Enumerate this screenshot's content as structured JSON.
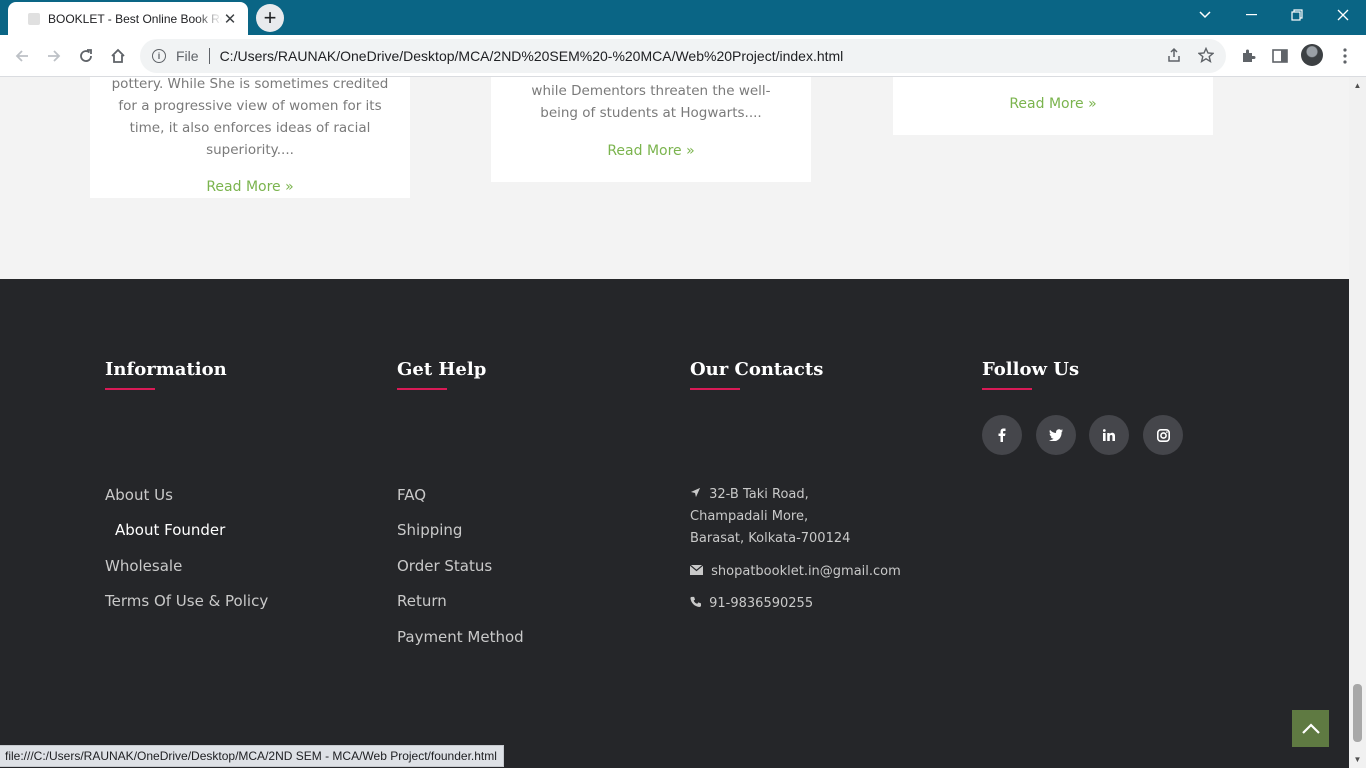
{
  "browser": {
    "tab_title": "BOOKLET - Best Online Book Reader",
    "new_tab_symbol": "+",
    "file_label": "File",
    "url": "C:/Users/RAUNAK/OneDrive/Desktop/MCA/2ND%20SEM%20-%20MCA/Web%20Project/index.html",
    "status_url": "file:///C:/Users/RAUNAK/OneDrive/Desktop/MCA/2ND SEM - MCA/Web Project/founder.html"
  },
  "cards": [
    {
      "excerpt": "pottery. While She is sometimes credited for a progressive view of women for its time, it also enforces ideas of racial superiority....",
      "read_more": "Read More »"
    },
    {
      "excerpt": "while Dementors threaten the well-being of students at Hogwarts....",
      "read_more": "Read More »"
    },
    {
      "excerpt": "",
      "read_more": "Read More »"
    }
  ],
  "footer": {
    "information": {
      "title": "Information",
      "links": [
        "About Us",
        "About Founder",
        "Wholesale",
        "Terms Of Use & Policy"
      ]
    },
    "get_help": {
      "title": "Get Help",
      "links": [
        "FAQ",
        "Shipping",
        "Order Status",
        "Return",
        "Payment Method"
      ]
    },
    "contacts": {
      "title": "Our Contacts",
      "address_line1": "32-B Taki Road,",
      "address_line2": "Champadali More,",
      "address_line3": "Barasat, Kolkata-700124",
      "email": "shopatbooklet.in@gmail.com",
      "phone": "91-9836590255"
    },
    "follow": {
      "title": "Follow Us",
      "icons": [
        "facebook-icon",
        "twitter-icon",
        "linkedin-icon",
        "instagram-icon"
      ]
    }
  },
  "colors": {
    "accent_underline": "#d81a56",
    "read_more": "#7bb44e",
    "footer_bg": "#252629",
    "browser_frame": "#0a6585"
  }
}
